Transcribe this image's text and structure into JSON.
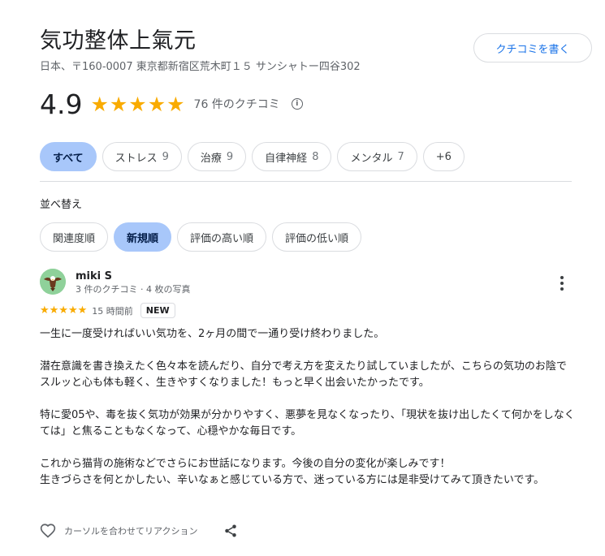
{
  "place": {
    "name": "気功整体上氣元",
    "address": "日本、〒160-0007 東京都新宿区荒木町１５ サンシャトー四谷302"
  },
  "write_review_label": "クチコミを書く",
  "summary": {
    "rating": "4.9",
    "stars": "★★★★★",
    "review_count": "76 件のクチコミ",
    "info_icon": "ⓘ"
  },
  "topics": [
    {
      "label": "すべて",
      "count": ""
    },
    {
      "label": "ストレス",
      "count": "9"
    },
    {
      "label": "治療",
      "count": "9"
    },
    {
      "label": "自律神経",
      "count": "8"
    },
    {
      "label": "メンタル",
      "count": "7"
    },
    {
      "label": "+6",
      "count": ""
    }
  ],
  "sort": {
    "label": "並べ替え",
    "options": [
      "関連度順",
      "新規順",
      "評価の高い順",
      "評価の低い順"
    ]
  },
  "review": {
    "author": "miki S",
    "author_meta": "3 件のクチコミ · 4 枚の写真",
    "stars": "★★★★★",
    "time": "15 時間前",
    "badge": "NEW",
    "paragraphs": [
      "一生に一度受ければいい気功を、2ヶ月の間で一通り受け終わりました。",
      "潜在意識を書き換えたく色々本を読んだり、自分で考え方を変えたり試していましたが、こちらの気功のお陰でスルッと心も体も軽く、生きやすくなりました！もっと早く出会いたかったです。",
      "特に愛05や、毒を抜く気功が効果が分かりやすく、悪夢を見なくなったり、「現状を抜け出したくて何かをしなくては」と焦ることもなくなって、心穏やかな毎日です。",
      "これから猫背の施術などでさらにお世話になります。今後の自分の変化が楽しみです！\n生きづらさを何とかしたい、辛いなぁと感じている方で、迷っている方には是非受けてみて頂きたいです。"
    ]
  },
  "actions": {
    "react_label": "カーソルを合わせてリアクション"
  },
  "colors": {
    "accent": "#1a73e8",
    "star": "#f9ab00",
    "selected_chip": "#a8c7fa"
  }
}
